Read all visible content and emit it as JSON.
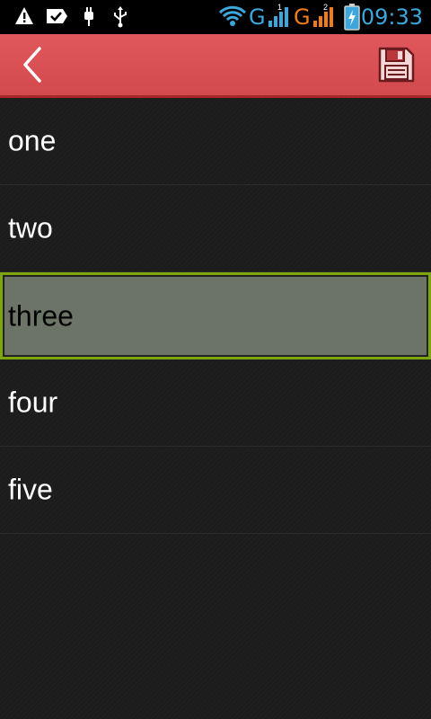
{
  "status_bar": {
    "time": "09:33",
    "network_1": "G",
    "network_2": "G",
    "sim_1": "1",
    "sim_2": "2",
    "icons": [
      "warning-icon",
      "message-check-icon",
      "usb-plug-icon",
      "usb-icon",
      "wifi-icon",
      "signal-1-icon",
      "signal-2-icon",
      "battery-charging-icon"
    ],
    "colors": {
      "clock": "#3ba7dc",
      "network_1": "#3ba7dc",
      "network_2": "#f07c1a"
    }
  },
  "action_bar": {
    "back_icon": "chevron-left-icon",
    "save_icon": "floppy-disk-icon",
    "color": "#d9505a"
  },
  "list": {
    "selected_index": 2,
    "items": [
      {
        "label": "one"
      },
      {
        "label": "two"
      },
      {
        "label": "three"
      },
      {
        "label": "four"
      },
      {
        "label": "five"
      }
    ]
  }
}
